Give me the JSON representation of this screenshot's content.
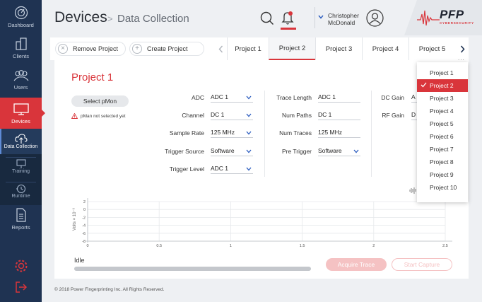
{
  "sidebar": {
    "items": [
      {
        "label": "Dashboard",
        "icon": "dashboard-icon"
      },
      {
        "label": "Clients",
        "icon": "clients-icon"
      },
      {
        "label": "Users",
        "icon": "users-icon"
      },
      {
        "label": "Devices",
        "icon": "devices-icon"
      },
      {
        "label": "Reports",
        "icon": "reports-icon"
      }
    ],
    "subitems": [
      {
        "label": "Data Collection",
        "icon": "cloud-upload-icon"
      },
      {
        "label": "Training",
        "icon": "training-icon"
      },
      {
        "label": "Runtime",
        "icon": "runtime-icon"
      }
    ]
  },
  "header": {
    "title": "Devices",
    "separator": ">",
    "breadcrumb": "Data Collection",
    "user_first": "Christopher",
    "user_last": "McDonald",
    "logo": "PFP",
    "logo_sub": "CYBERSECURITY"
  },
  "toolbar": {
    "remove_label": "Remove Project",
    "create_label": "Create Project",
    "tabs": [
      "Project 1",
      "Project 2",
      "Project 3",
      "Project 4",
      "Project 5"
    ],
    "ellipsis": "..."
  },
  "project": {
    "title": "Project 1",
    "pmon_button": "Select pMon",
    "warning": "pMan not selected yet"
  },
  "fields": {
    "adc": {
      "label": "ADC",
      "value": "ADC 1"
    },
    "channel": {
      "label": "Channel",
      "value": "DC 1"
    },
    "sample_rate": {
      "label": "Sample Rate",
      "value": "125 MHz"
    },
    "trigger_source": {
      "label": "Trigger Source",
      "value": "Software"
    },
    "trigger_level": {
      "label": "Trigger Level",
      "value": "ADC 1"
    },
    "trace_length": {
      "label": "Trace Length",
      "value": "ADC 1"
    },
    "num_paths": {
      "label": "Num Paths",
      "value": "DC 1"
    },
    "num_traces": {
      "label": "Num Traces",
      "value": "125 MHz"
    },
    "pre_trigger": {
      "label": "Pre Trigger",
      "value": "Software"
    },
    "dc_gain": {
      "label": "DC Gain",
      "value": "A"
    },
    "rf_gain": {
      "label": "RF Gain",
      "value": "D"
    }
  },
  "dropdown": {
    "items": [
      "Project 1",
      "Project 2",
      "Project 3",
      "Project 4",
      "Project 5",
      "Project 6",
      "Project 7",
      "Project 8",
      "Project 9",
      "Project 10"
    ],
    "selected": "Project 2"
  },
  "chart_data": {
    "type": "line",
    "ylabel": "Volts × 10⁻⁶",
    "x_ticks": [
      "0",
      "0.5",
      "1",
      "1.5",
      "2",
      "2.5"
    ],
    "y_ticks": [
      "2",
      "0",
      "-2",
      "-4",
      "-6",
      "-8"
    ],
    "xlim": [
      0,
      2.5
    ],
    "ylim": [
      -8,
      2
    ],
    "grid": true,
    "series": []
  },
  "status": {
    "state": "Idle",
    "progress": 0,
    "acquire_label": "Acquire Trace",
    "capture_label": "Start Capture"
  },
  "footer": {
    "copyright": "© 2018 Power Fingerprinting Inc. All Rights Reserved."
  },
  "colors": {
    "accent": "#d9353b",
    "sidebar": "#1f3352"
  }
}
